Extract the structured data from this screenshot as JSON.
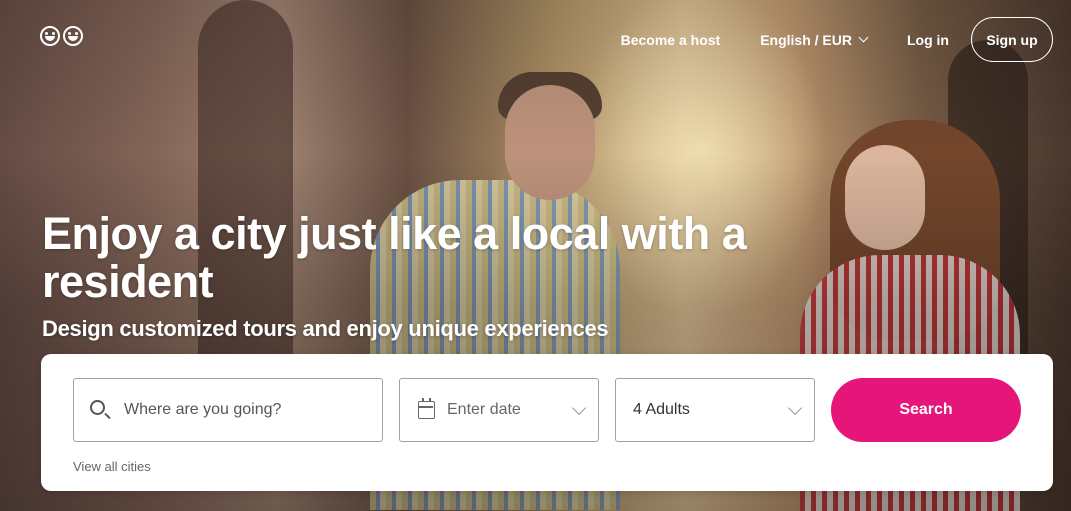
{
  "nav": {
    "become_host": "Become a host",
    "language_currency": "English / EUR",
    "login": "Log in",
    "signup": "Sign up"
  },
  "hero": {
    "title": "Enjoy a city just like a local with a resident",
    "subtitle": "Design customized tours and enjoy unique experiences"
  },
  "search": {
    "destination_placeholder": "Where are you going?",
    "date_placeholder": "Enter date",
    "guests_value": "4 Adults",
    "button_label": "Search",
    "view_all_cities": "View all cities"
  },
  "colors": {
    "accent": "#e6157a"
  },
  "icons": [
    "logo-icon",
    "chevron-down-icon",
    "search-icon",
    "calendar-icon"
  ]
}
